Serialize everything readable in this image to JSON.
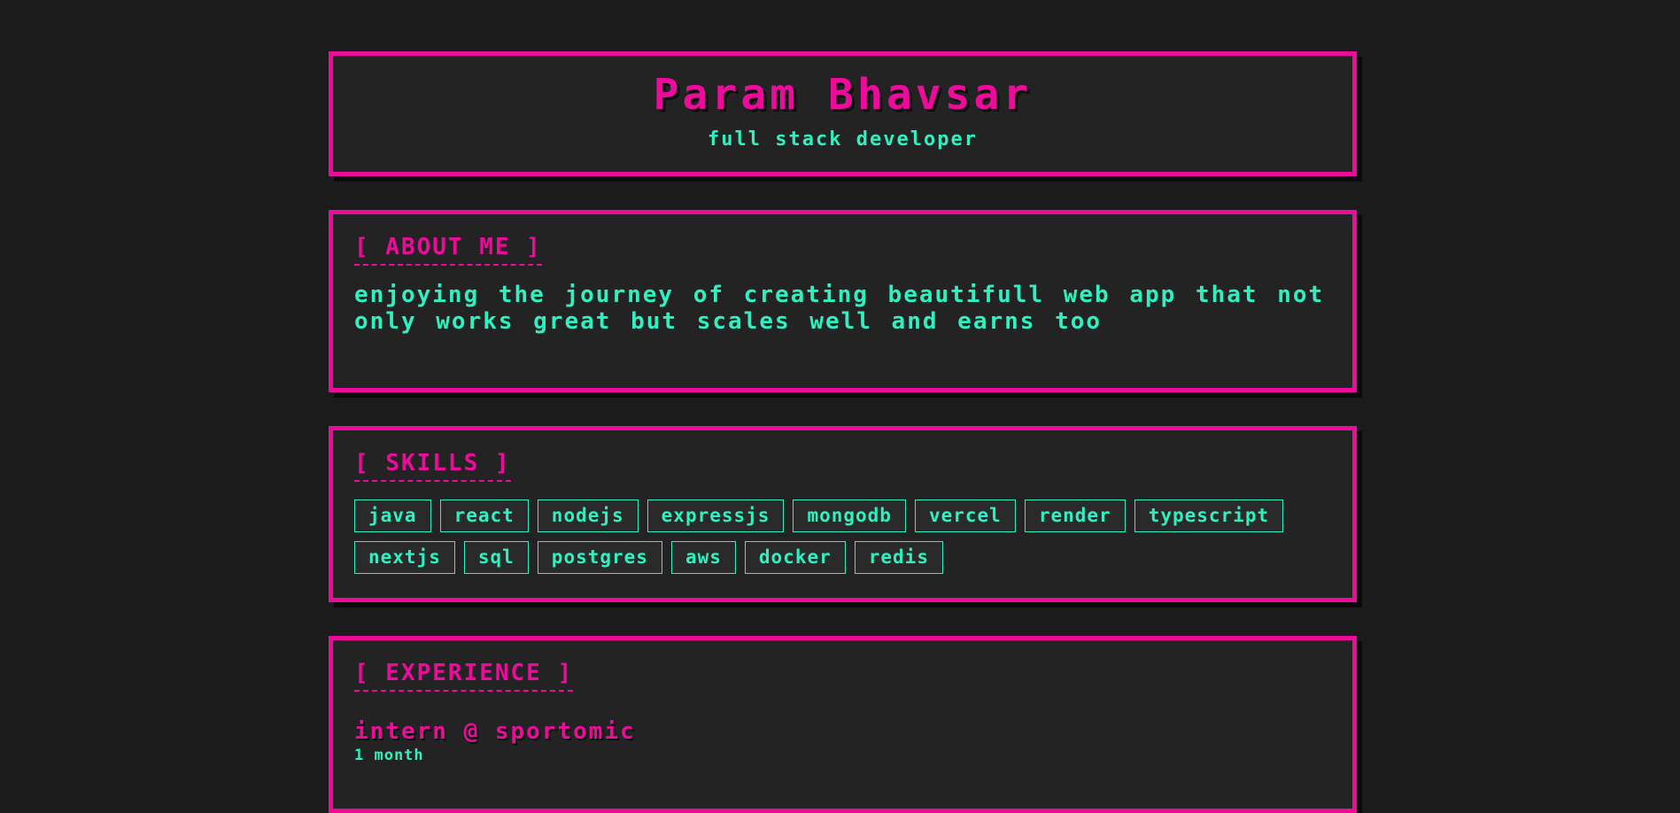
{
  "header": {
    "name": "Param Bhavsar",
    "role": "full stack developer"
  },
  "about": {
    "heading": "[ ABOUT ME ]",
    "text": "enjoying the journey of creating beautifull web app that not only works great but scales well and earns too"
  },
  "skills": {
    "heading": "[ SKILLS ]",
    "items": [
      "java",
      "react",
      "nodejs",
      "expressjs",
      "mongodb",
      "vercel",
      "render",
      "typescript",
      "nextjs",
      "sql",
      "postgres",
      "aws",
      "docker",
      "redis"
    ]
  },
  "experience": {
    "heading": "[ EXPERIENCE ]",
    "jobs": [
      {
        "title": "intern @ sportomic",
        "duration": "1 month"
      }
    ]
  },
  "colors": {
    "background": "#1b1b1b",
    "card": "#232323",
    "accent_pink": "#ec0b9b",
    "accent_teal": "#2ff0c0"
  }
}
